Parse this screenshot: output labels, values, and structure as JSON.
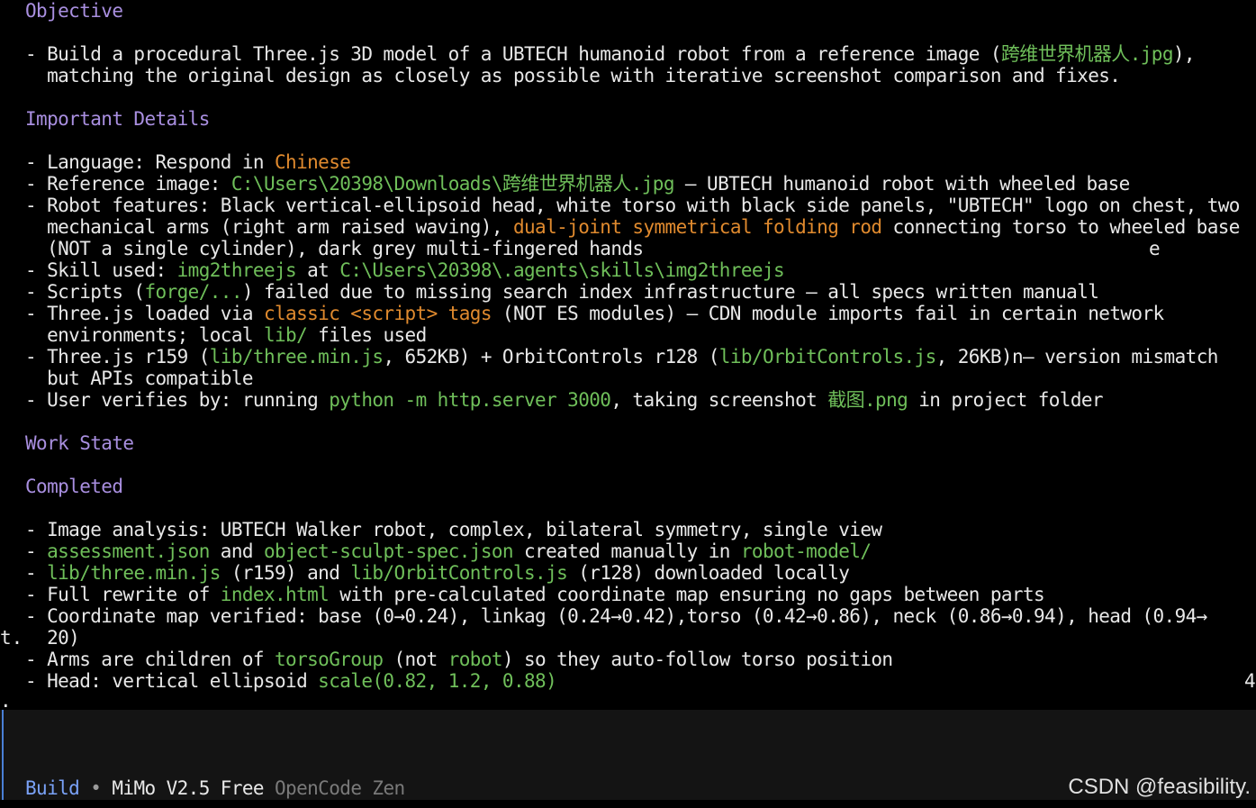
{
  "sections": {
    "objective": {
      "title": "Objective",
      "line1a": "- Build a procedural Three.js 3D model of a UBTECH humanoid robot from a reference image (",
      "line1b": "跨维世界机器人.jpg",
      "line1c": "),",
      "line2": "  matching the original design as closely as possible with iterative screenshot comparison and fixes."
    },
    "details": {
      "title": "Important Details",
      "lang_a": "- Language: Respond in ",
      "lang_b": "Chinese",
      "ref_a": "- Reference image: ",
      "ref_b": "C:\\Users\\20398\\Downloads\\跨维世界机器人.jpg",
      "ref_c": " — UBTECH humanoid robot with wheeled base",
      "feat1": "- Robot features: Black vertical-ellipsoid head, white torso with black side panels, \"UBTECH\" logo on chest, two",
      "feat2a": "  mechanical arms (right arm raised waving), ",
      "feat2b": "dual-joint symmetrical folding rod",
      "feat2c": " connecting torso to wheeled base",
      "feat3": "  (NOT a single cylinder), dark grey multi-fingered hands",
      "feat3_stray": "e",
      "skill_a": "- Skill used: ",
      "skill_b": "img2threejs",
      "skill_c": " at ",
      "skill_d": "C:\\Users\\20398\\.agents\\skills\\img2threejs",
      "scripts_a": "- Scripts (",
      "scripts_b": "forge/...",
      "scripts_c": ") failed due to missing search index infrastructure — all specs written manuall",
      "three1a": "- Three.js loaded via ",
      "three1b": "classic <script> tags",
      "three1c": " (NOT ES modules) — CDN module imports fail in certain network",
      "three2a": "  environments; local ",
      "three2b": "lib/",
      "three2c": " files used",
      "ver1a": "- Three.js r159 (",
      "ver1b": "lib/three.min.js",
      "ver1c": ", 652KB) + OrbitControls r128 (",
      "ver1d": "lib/OrbitControls.js",
      "ver1e": ", 26KB)n— version mismatch",
      "ver2": "  but APIs compatible",
      "user_a": "- User verifies by: running ",
      "user_b": "python -m http.server 3000",
      "user_c": ", taking screenshot ",
      "user_d": "截图.png",
      "user_e": " in project folder"
    },
    "work_state": {
      "title": "Work State"
    },
    "completed": {
      "title": "Completed",
      "img": "- Image analysis: UBTECH Walker robot, complex, bilateral symmetry, single view",
      "assess_a": "- ",
      "assess_b": "assessment.json",
      "assess_c": " and ",
      "assess_d": "object-sculpt-spec.json",
      "assess_e": " created manually in ",
      "assess_f": "robot-model/",
      "lib_a": "- ",
      "lib_b": "lib/three.min.js",
      "lib_c": " (r159) and ",
      "lib_d": "lib/OrbitControls.js",
      "lib_e": " (r128) downloaded locally",
      "rewrite_a": "- Full rewrite of ",
      "rewrite_b": "index.html",
      "rewrite_c": " with pre-calculated coordinate map ensuring no gaps between parts",
      "coord1": "- Coordinate map verified: base (0→0.24), linkag (0.24→0.42),torso (0.42→0.86), neck (0.86→0.94), head (0.94→",
      "coord1_stray": "t.",
      "coord2": "  20)",
      "arms_a": "- Arms are children of ",
      "arms_b": "torsoGroup",
      "arms_c": " (not ",
      "arms_d": "robot",
      "arms_e": ") so they auto-follow torso position",
      "head_a": "- Head: vertical ellipsoid ",
      "head_b": "scale(0.82, 1.2, 0.88)",
      "head_stray": "4",
      "bottom_stray": "."
    }
  },
  "status_bar": {
    "mode": "Build",
    "separator": " • ",
    "model": "MiMo V2.5 Free",
    "provider": " OpenCode Zen"
  },
  "watermark": "CSDN @feasibility.",
  "colors": {
    "heading": "#a98fe0",
    "highlight_green": "#6fbf5a",
    "highlight_orange": "#e08a2e",
    "mode": "#7aa2f7",
    "input_bar": "#4a7fd6"
  }
}
